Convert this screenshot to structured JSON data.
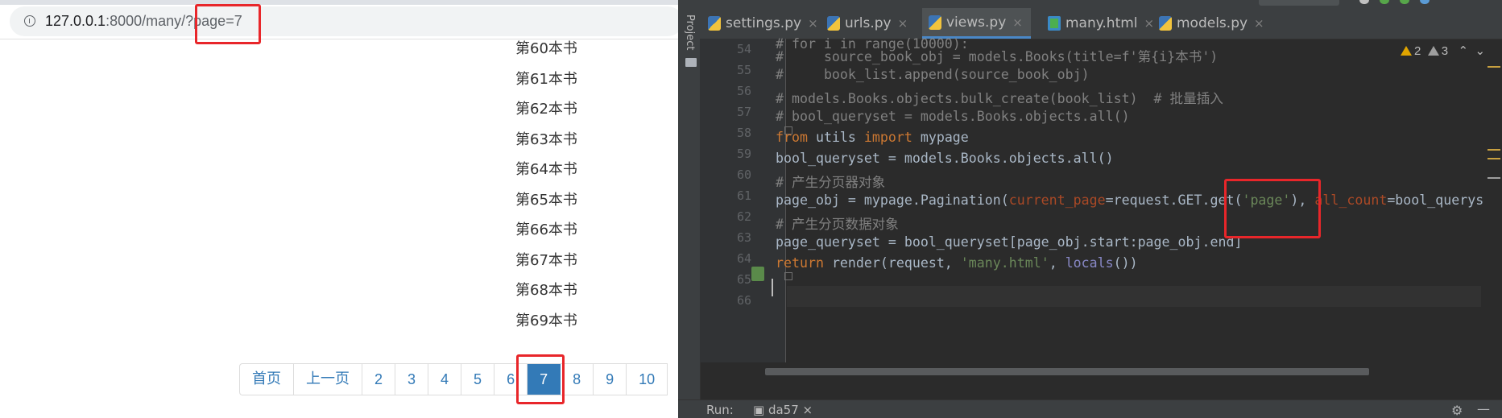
{
  "browser": {
    "address": {
      "host": "127.0.0.1",
      "rest": ":8000/many/?page=7"
    },
    "books": [
      "第60本书",
      "第61本书",
      "第62本书",
      "第63本书",
      "第64本书",
      "第65本书",
      "第66本书",
      "第67本书",
      "第68本书",
      "第69本书"
    ],
    "pagination": {
      "first": "首页",
      "prev": "上一页",
      "pages": [
        "2",
        "3",
        "4",
        "5",
        "6",
        "7",
        "8",
        "9",
        "10"
      ],
      "active": "7"
    }
  },
  "ide": {
    "project_label": "Project",
    "tabs": [
      "settings.py",
      "urls.py",
      "views.py",
      "many.html",
      "models.py"
    ],
    "active_tab": "views.py",
    "line_numbers": [
      "54",
      "55",
      "56",
      "57",
      "58",
      "59",
      "60",
      "61",
      "62",
      "63",
      "64",
      "65",
      "66"
    ],
    "code": {
      "l54": "# for i in range(10000):",
      "l55": "#     source_book_obj = models.Books(title=f'第{i}本书')",
      "l56": "#     book_list.append(source_book_obj)",
      "l57": "# models.Books.objects.bulk_create(book_list)  # 批量插入",
      "l58": "# bool_queryset = models.Books.objects.all()",
      "l59_kw1": "from",
      "l59_mid": " utils ",
      "l59_kw2": "import",
      "l59_end": " mypage",
      "l60": "bool_queryset = models.Books.objects.all()",
      "l61": "# 产生分页器对象",
      "l62_a": "page_obj = mypage.Pagination(",
      "l62_p1": "current_page",
      "l62_b": "=request.GET.get(",
      "l62_s": "'page'",
      "l62_c": "), ",
      "l62_p2": "all_count",
      "l62_d": "=bool_querys",
      "l63": "# 产生分页数据对象",
      "l64": "page_queryset = bool_queryset[page_obj.start:page_obj.end]",
      "l65_kw": "return",
      "l65_a": " render(request, ",
      "l65_s": "'many.html'",
      "l65_b": ", ",
      "l65_bi": "locals",
      "l65_c": "())"
    },
    "inspections": {
      "warnings": "2",
      "weak": "3"
    },
    "run_bar": {
      "label": "Run:",
      "config": "da57"
    }
  },
  "colors": {
    "highlight": "#e8262a",
    "bootstrap_blue": "#337ab7",
    "ide_bg": "#2b2b2b",
    "keyword": "#cc7832",
    "string": "#6a8759",
    "comment": "#808080"
  }
}
